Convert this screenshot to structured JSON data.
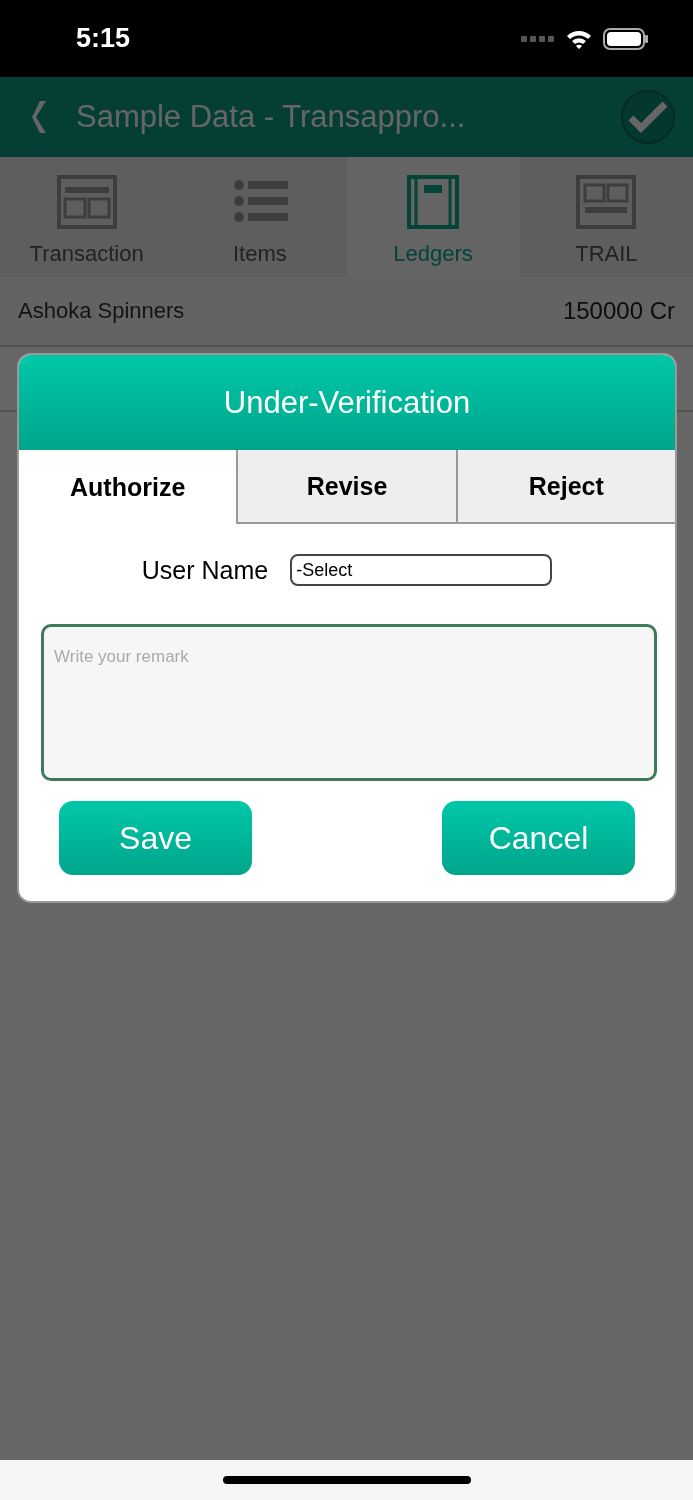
{
  "status_bar": {
    "time": "5:15"
  },
  "header": {
    "title": "Sample Data - Transappro..."
  },
  "tabs": [
    {
      "label": "Transaction",
      "selected": false
    },
    {
      "label": "Items",
      "selected": false
    },
    {
      "label": "Ledgers",
      "selected": true
    },
    {
      "label": "TRAIL",
      "selected": false
    }
  ],
  "ledgers": [
    {
      "name": "Ashoka Spinners",
      "amount": "150000 Cr"
    }
  ],
  "dialog": {
    "title": "Under-Verification",
    "tabs": [
      {
        "label": "Authorize",
        "selected": true
      },
      {
        "label": "Revise",
        "selected": false
      },
      {
        "label": "Reject",
        "selected": false
      }
    ],
    "user_name": {
      "label": "User Name",
      "value": "-Select"
    },
    "remark": {
      "placeholder": "Write your remark"
    },
    "buttons": [
      "Save",
      "Cancel"
    ]
  }
}
